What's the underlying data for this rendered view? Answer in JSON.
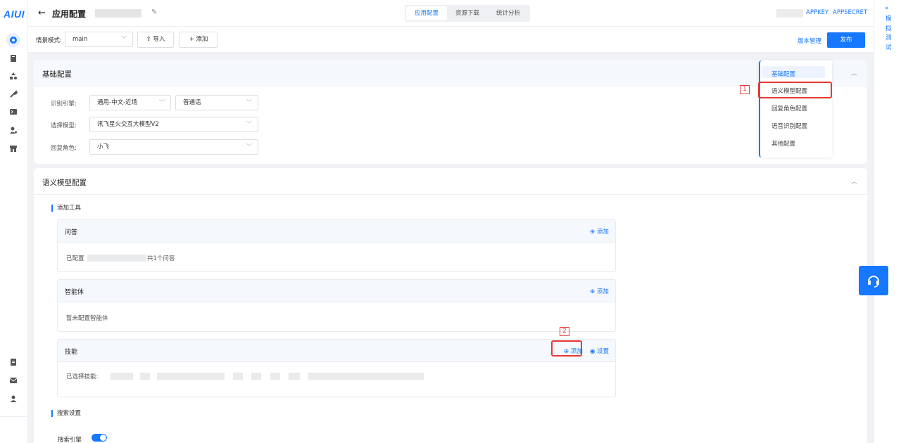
{
  "logo": "AIUI",
  "header": {
    "title": "应用配置",
    "edit_icon": "pencil-icon",
    "tabs": [
      "应用配置",
      "资源下载",
      "统计分析"
    ],
    "appkey": "APPKEY",
    "appsecret": "APPSECRET"
  },
  "toolbar": {
    "scene_label": "情景模式:",
    "scene_value": "main",
    "import_label": "导入",
    "add_label": "添加",
    "version_label": "版本管理",
    "publish_label": "发布"
  },
  "right_panel": {
    "collapse": "«",
    "text": "模拟测试"
  },
  "basic": {
    "title": "基础配置",
    "engine_label": "识别引擎:",
    "engine_value": "通用-中文-近场",
    "accent_value": "普通话",
    "model_label": "选择模型:",
    "model_value": "讯飞星火交互大模型V2",
    "role_label": "回复角色:",
    "role_value": "小飞"
  },
  "anchors": [
    "基础配置",
    "语义模型配置",
    "回复角色配置",
    "语音识别配置",
    "其他配置"
  ],
  "semantic": {
    "title": "语义模型配置",
    "tools_label": "添加工具",
    "qa": {
      "title": "问答",
      "add": "添加",
      "text_prefix": "已配置",
      "text_suffix": "共1个问答"
    },
    "agent": {
      "title": "智能体",
      "add": "添加",
      "text": "暂未配置智能体"
    },
    "skill": {
      "title": "技能",
      "add": "添加",
      "settings": "设置",
      "text": "已选择技能:"
    },
    "search_section": "搜索设置",
    "search_engine": "搜索引擎"
  },
  "annotations": {
    "one": "1",
    "two": "2"
  },
  "colors": {
    "accent": "#1677ff",
    "highlight": "#e53935",
    "background": "#f0f2f5"
  }
}
